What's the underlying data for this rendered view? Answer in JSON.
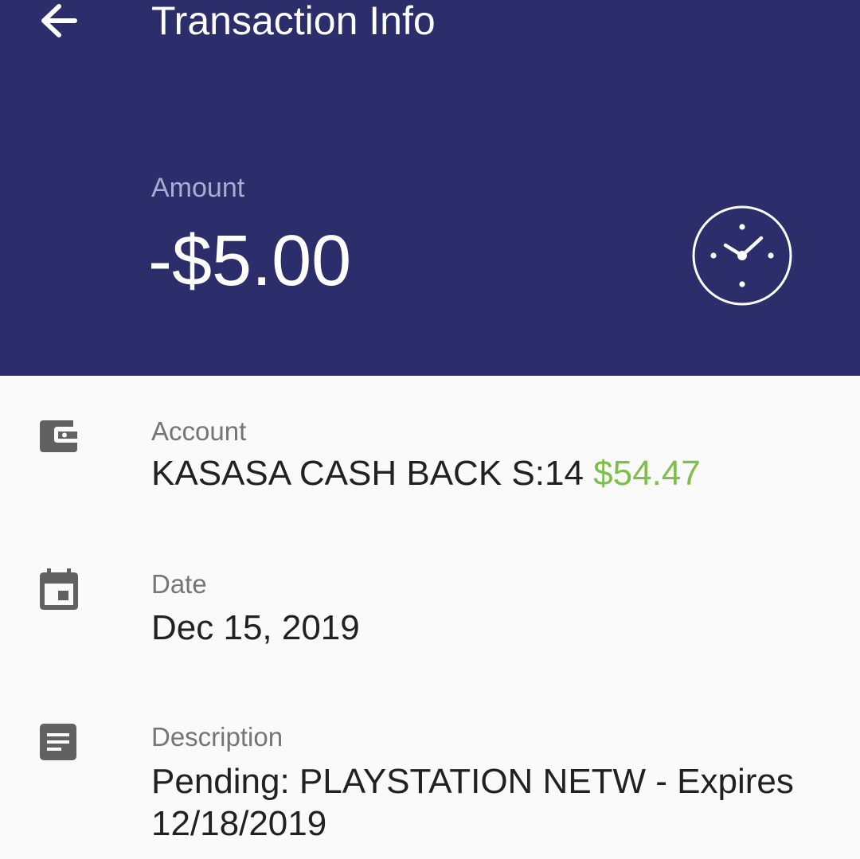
{
  "header": {
    "title": "Transaction Info",
    "back_icon": "arrow-back-icon",
    "background_color": "#2b2e6b"
  },
  "amount": {
    "label": "Amount",
    "value": "-$5.00",
    "status_icon": "clock-pending-icon"
  },
  "details": {
    "account": {
      "icon": "wallet-icon",
      "label": "Account",
      "name": "KASASA CASH BACK S:14",
      "balance": "$54.47",
      "balance_color": "#7cc04b"
    },
    "date": {
      "icon": "calendar-icon",
      "label": "Date",
      "value": "Dec 15, 2019"
    },
    "description": {
      "icon": "description-icon",
      "label": "Description",
      "line1": "Pending: PLAYSTATION NETW - Expires",
      "line2": "12/18/2019"
    }
  }
}
